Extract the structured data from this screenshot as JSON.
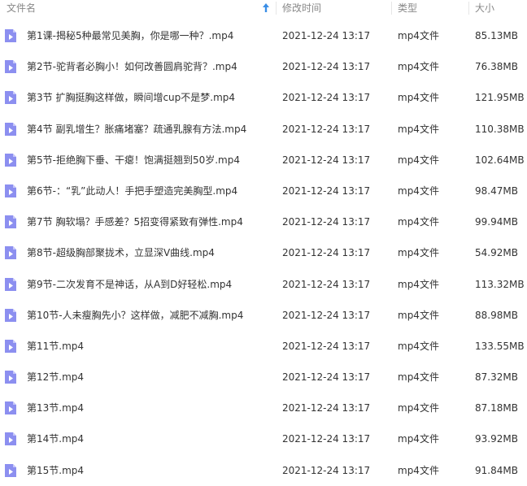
{
  "header": {
    "name_label": "文件名",
    "date_label": "修改时间",
    "type_label": "类型",
    "size_label": "大小"
  },
  "colors": {
    "icon": "#8c8ff0",
    "icon_fold": "#c7c8fa",
    "sort_arrow": "#3a8ee6"
  },
  "files": [
    {
      "name": "第1课-揭秘5种最常见美胸，你是哪一种？.mp4",
      "date": "2021-12-24 13:17",
      "type": "mp4文件",
      "size": "85.13MB"
    },
    {
      "name": "第2节-驼背者必胸小！如何改善圆肩驼背？.mp4",
      "date": "2021-12-24 13:17",
      "type": "mp4文件",
      "size": "76.38MB"
    },
    {
      "name": "第3节 扩胸挺胸这样做，瞬间增cup不是梦.mp4",
      "date": "2021-12-24 13:17",
      "type": "mp4文件",
      "size": "121.95MB"
    },
    {
      "name": "第4节 副乳增生？胀痛堵塞？疏通乳腺有方法.mp4",
      "date": "2021-12-24 13:17",
      "type": "mp4文件",
      "size": "110.38MB"
    },
    {
      "name": "第5节-拒绝胸下垂、干瘪！饱满挺翘到50岁.mp4",
      "date": "2021-12-24 13:17",
      "type": "mp4文件",
      "size": "102.64MB"
    },
    {
      "name": "第6节-：“乳”此动人！手把手塑造完美胸型.mp4",
      "date": "2021-12-24 13:17",
      "type": "mp4文件",
      "size": "98.47MB"
    },
    {
      "name": "第7节 胸软塌？手感差？5招变得紧致有弹性.mp4",
      "date": "2021-12-24 13:17",
      "type": "mp4文件",
      "size": "99.94MB"
    },
    {
      "name": "第8节-超级胸部聚拢术，立显深V曲线.mp4",
      "date": "2021-12-24 13:17",
      "type": "mp4文件",
      "size": "54.92MB"
    },
    {
      "name": "第9节-二次发育不是神话，从A到D好轻松.mp4",
      "date": "2021-12-24 13:17",
      "type": "mp4文件",
      "size": "113.32MB"
    },
    {
      "name": "第10节-人未瘦胸先小？这样做，减肥不减胸.mp4",
      "date": "2021-12-24 13:17",
      "type": "mp4文件",
      "size": "88.98MB"
    },
    {
      "name": "第11节.mp4",
      "date": "2021-12-24 13:17",
      "type": "mp4文件",
      "size": "133.55MB"
    },
    {
      "name": "第12节.mp4",
      "date": "2021-12-24 13:17",
      "type": "mp4文件",
      "size": "87.32MB"
    },
    {
      "name": "第13节.mp4",
      "date": "2021-12-24 13:17",
      "type": "mp4文件",
      "size": "87.18MB"
    },
    {
      "name": "第14节.mp4",
      "date": "2021-12-24 13:17",
      "type": "mp4文件",
      "size": "93.92MB"
    },
    {
      "name": "第15节.mp4",
      "date": "2021-12-24 13:17",
      "type": "mp4文件",
      "size": "91.84MB"
    }
  ]
}
